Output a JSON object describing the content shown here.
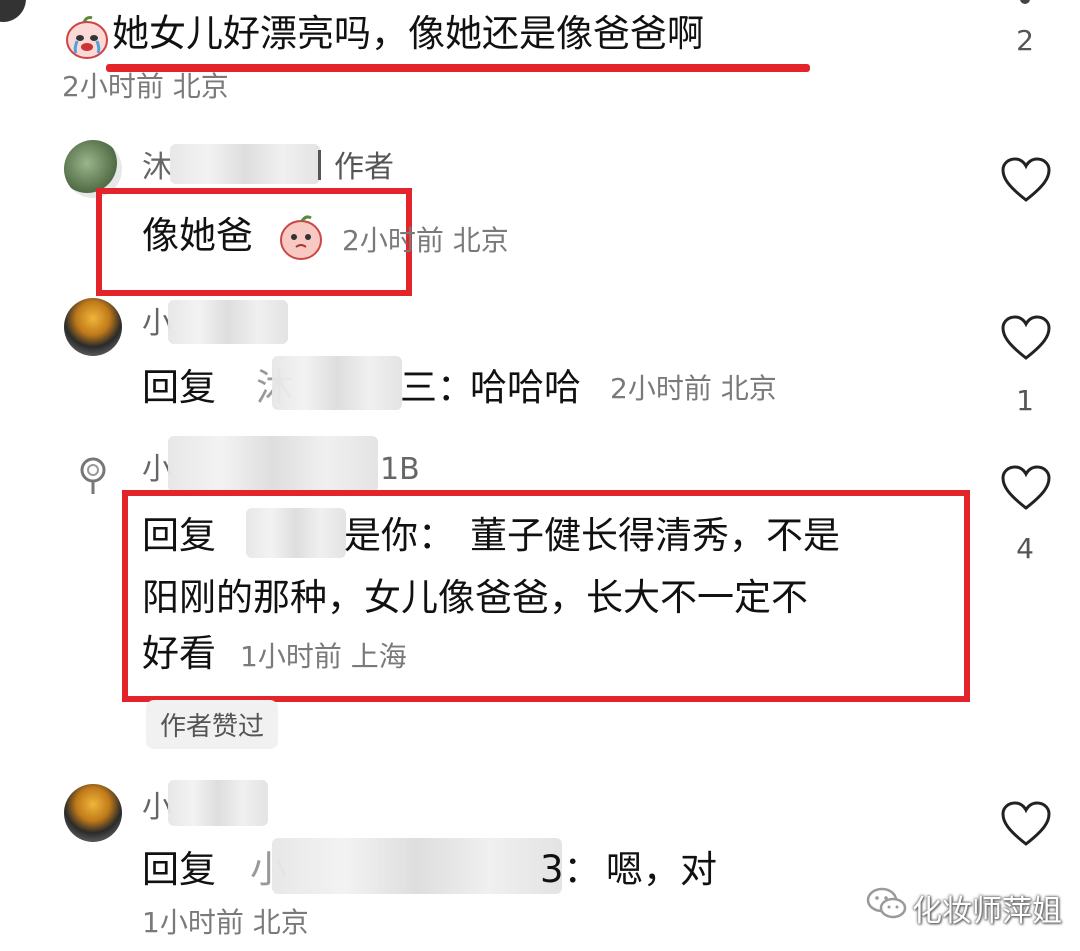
{
  "comment_top": {
    "text": "她女儿好漂亮吗，像她还是像爸爸啊",
    "meta": "2小时前  北京",
    "like_count": "2",
    "emoji_icon": "crying-peach-emoji-icon"
  },
  "reply_author": {
    "name_visible": "沐",
    "author_tag": "作者",
    "text": "像她爸",
    "meta": "2小时前  北京",
    "emoji_icon": "peach-emoji-icon"
  },
  "reply_haha": {
    "name_visible": "小",
    "reply_prefix": "回复",
    "target_visible": "沐",
    "target_end": "三：",
    "text": "哈哈哈",
    "meta": "2小时前  北京",
    "like_count": "1"
  },
  "reply_long": {
    "name_visible": "小",
    "name_end": "1B",
    "reply_prefix": "回复",
    "target_end": "是你：",
    "line1": "董子健长得清秀，不是",
    "line2": "阳刚的那种，女儿像爸爸，长大不一定不",
    "line3": "好看",
    "meta": "1小时前  上海",
    "like_count": "4",
    "author_liked_badge": "作者赞过"
  },
  "reply_last": {
    "name_visible": "小",
    "reply_prefix": "回复",
    "target_visible": "小",
    "target_end": "3：",
    "text": "嗯，对",
    "meta": "1小时前  北京"
  },
  "watermark": {
    "text": "化妆师萍姐",
    "icon": "wechat-icon"
  },
  "colors": {
    "highlight_red": "#e3242b",
    "meta_gray": "#7a7a7a"
  }
}
